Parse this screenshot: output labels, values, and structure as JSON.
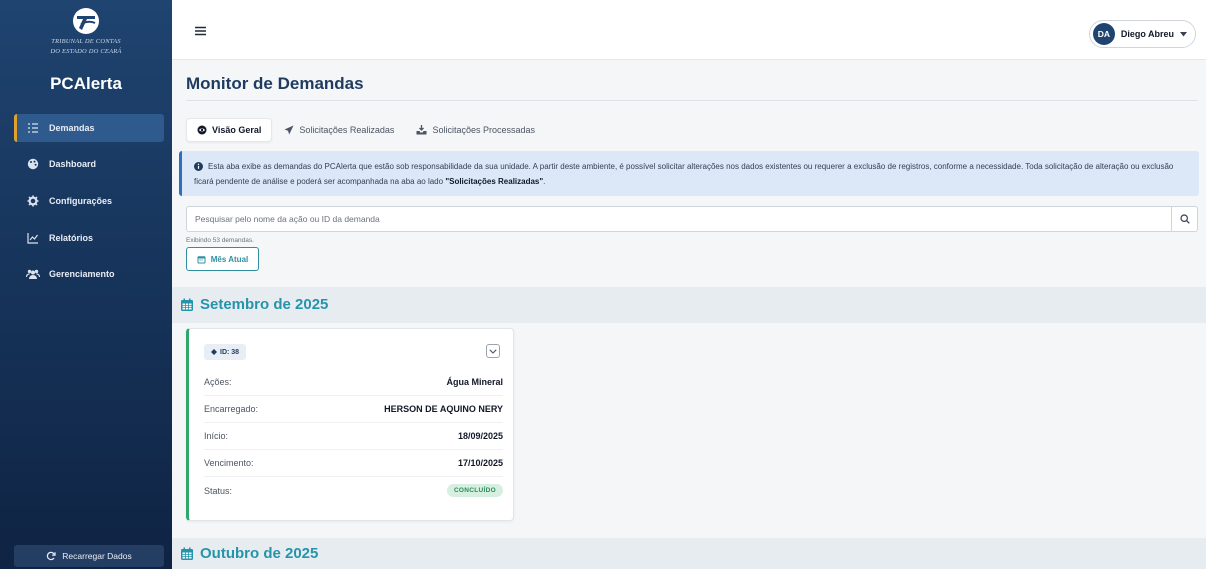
{
  "sidebar": {
    "logo_text_line1": "TRIBUNAL DE CONTAS",
    "logo_text_line2": "DO ESTADO DO CEARÁ",
    "brand": "PCAlerta",
    "items": [
      {
        "label": "Demandas",
        "icon": "list-icon",
        "active": true
      },
      {
        "label": "Dashboard",
        "icon": "palette-icon"
      },
      {
        "label": "Configurações",
        "icon": "gear-icon"
      },
      {
        "label": "Relatórios",
        "icon": "line-chart-icon"
      },
      {
        "label": "Gerenciamento",
        "icon": "users-icon"
      }
    ],
    "reload_label": "Recarregar Dados"
  },
  "topbar": {
    "user_initials": "DA",
    "user_name": "Diego Abreu"
  },
  "main": {
    "title": "Monitor de Demandas",
    "tabs": [
      {
        "label": "Visão Geral",
        "icon": "eye-icon",
        "active": true
      },
      {
        "label": "Solicitações Realizadas",
        "icon": "paper-plane-icon"
      },
      {
        "label": "Solicitações Processadas",
        "icon": "inbox-icon"
      }
    ],
    "alert": {
      "text": "Esta aba exibe as demandas do PCAlerta que estão sob responsabilidade da sua unidade. A partir deste ambiente, é possível solicitar alterações nos dados existentes ou requerer a exclusão de registros, conforme a necessidade. Toda solicitação de alteração ou exclusão ficará pendente de análise e poderá ser acompanhada na aba ao lado ",
      "bold": "\"Solicitações Realizadas\"",
      "end": "."
    },
    "search": {
      "placeholder": "Pesquisar pelo nome da ação ou ID da demanda",
      "value": ""
    },
    "count_text": "Exibindo 53 demandas.",
    "month_filter_label": "Mês Atual",
    "months": [
      {
        "label": "Setembro de 2025"
      },
      {
        "label": "Outubro de 2025"
      }
    ],
    "card": {
      "id_label": "ID: 38",
      "rows": {
        "acoes": {
          "label": "Ações:",
          "value": "Água Mineral"
        },
        "encarregado": {
          "label": "Encarregado:",
          "value": "HERSON DE AQUINO NERY"
        },
        "inicio": {
          "label": "Início:",
          "value": "18/09/2025"
        },
        "vencimento": {
          "label": "Vencimento:",
          "value": "17/10/2025"
        },
        "status": {
          "label": "Status:",
          "value": "CONCLUÍDO"
        }
      }
    }
  },
  "colors": {
    "sidebar_top": "#1f4470",
    "sidebar_bottom": "#0f2343",
    "accent_teal": "#2594aa",
    "active_marker": "#e0a22c",
    "status_green": "#2e8a58",
    "card_border": "#2ea86a",
    "title_blue": "#1f3b5f"
  }
}
